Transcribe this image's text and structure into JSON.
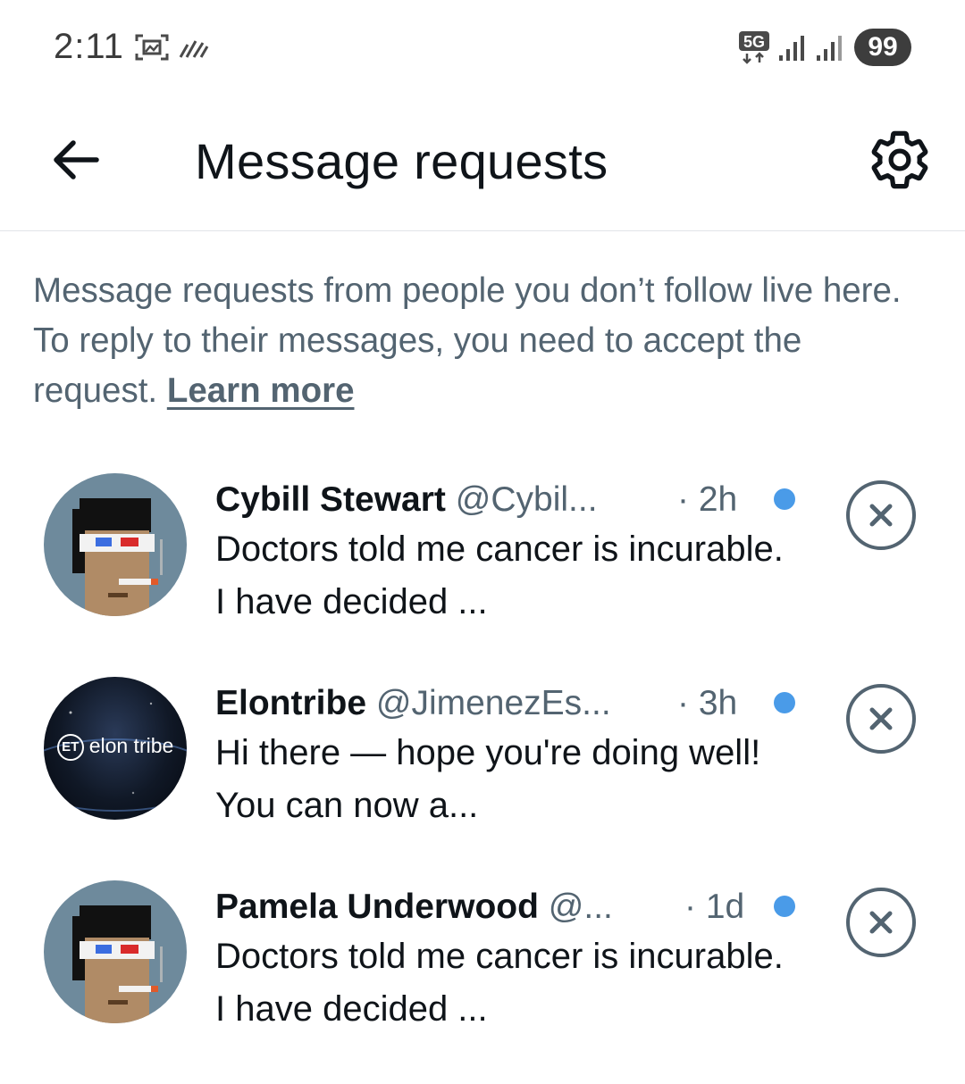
{
  "status_bar": {
    "time": "2:11",
    "network_label": "5G",
    "battery": "99",
    "icons": [
      "screenshot-icon",
      "activity-icon",
      "5g-icon",
      "signal-icon",
      "signal-icon"
    ]
  },
  "header": {
    "title": "Message requests",
    "back_icon": "arrow-left-icon",
    "settings_icon": "gear-icon"
  },
  "info": {
    "text": "Message requests from people you don’t follow live here. To reply to their messages, you need to accept the request. ",
    "link": "Learn more"
  },
  "requests": [
    {
      "name": "Cybill Stewart",
      "handle": "@Cybil...",
      "time": "· 2h",
      "preview": "Doctors told me cancer is incurable. I have decided ...",
      "avatar": "pixel-punk-avatar",
      "unread": true
    },
    {
      "name": "Elontribe",
      "handle": "@JimenezEs...",
      "time": "· 3h",
      "preview": "Hi there — hope you're doing well! You can now a...",
      "avatar": "elon-tribe-logo",
      "avatar_text": "elon tribe",
      "unread": true
    },
    {
      "name": "Pamela Underwood",
      "handle": "@...",
      "time": "· 1d",
      "preview": "Doctors told me cancer is incurable. I have decided ...",
      "avatar": "pixel-punk-avatar",
      "unread": true
    }
  ],
  "colors": {
    "text_primary": "#0f1419",
    "text_secondary": "#536471",
    "unread_dot": "#4a9be8",
    "divider": "#e1e4e8",
    "battery_badge": "#3d3d3d"
  }
}
